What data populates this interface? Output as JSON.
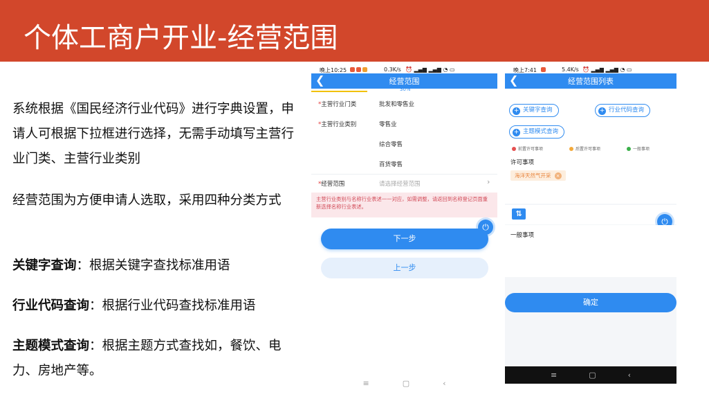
{
  "slide": {
    "title": "个体工商户开业-经营范围",
    "colors": {
      "banner": "#d2472b",
      "accent": "#2f8bf0"
    }
  },
  "body": {
    "p1": "系统根据《国民经济行业代码》进行字典设置，申请人可根据下拉框进行选择，无需手动填写主营行业门类、主营行业类别",
    "p2": "经营范围为方便申请人选取，采用四种分类方式",
    "kw_label": "关键字查询",
    "kw_text": "：根据关键字查找标准用语",
    "ind_label": "行业代码查询",
    "ind_text": "：根据行业代码查找标准用语",
    "theme_label": "主题模式查询",
    "theme_text": "：根据主题方式查找如，餐饮、电力、房地产等。"
  },
  "phone1": {
    "status_time": "晚上10:25",
    "status_right": "0.3K/s",
    "title": "经营范围",
    "progress": "30%",
    "progress_value": 0.3,
    "field1_label": "*主营行业门类",
    "field1_value": "批发和零售业",
    "field2_label": "*主营行业类别",
    "field2_value": "零售业",
    "field2_sub1": "综合零售",
    "field2_sub2": "百货零售",
    "scope_label": "*经营范围",
    "scope_placeholder": "请选择经营范围",
    "warning": "主营行业类别与名称行业表述一一对应，如需调整，请返回到名称登记页面重新选择名称行业表述。",
    "next_label": "下一步",
    "prev_label": "上一步",
    "nav": [
      "≡",
      "▢",
      "‹"
    ]
  },
  "phone2": {
    "status_time": "晚上7:41",
    "status_right": "5.4K/s",
    "title": "经营范围列表",
    "kw_btn": "关键字查询",
    "ind_btn": "行业代码查询",
    "theme_btn": "主题模式查询",
    "legend": [
      {
        "label": "前置许可事项",
        "color": "#e55050"
      },
      {
        "label": "后置许可事项",
        "color": "#f3a93a"
      },
      {
        "label": "一般事项",
        "color": "#3ab04a"
      }
    ],
    "licensed_label": "许可事项",
    "tag": "海洋天然气开采",
    "tag_close": "×",
    "general_label": "一般事项",
    "confirm_label": "确定",
    "nav": [
      "≡",
      "▢",
      "‹"
    ]
  }
}
